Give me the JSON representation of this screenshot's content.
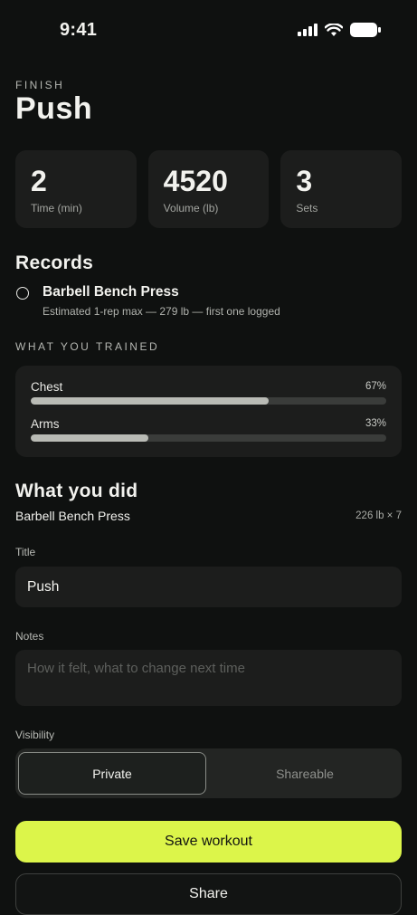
{
  "status": {
    "time": "9:41"
  },
  "header": {
    "eyebrow": "FINISH",
    "title": "Push"
  },
  "stats": [
    {
      "value": "2",
      "label": "Time (min)"
    },
    {
      "value": "4520",
      "label": "Volume (lb)"
    },
    {
      "value": "3",
      "label": "Sets"
    }
  ],
  "records": {
    "title": "Records",
    "items": [
      {
        "name": "Barbell Bench Press",
        "detail": "Estimated 1-rep max — 279 lb — first one logged"
      }
    ]
  },
  "trained": {
    "eyebrow": "WHAT YOU TRAINED",
    "muscles": [
      {
        "name": "Chest",
        "percent_label": "67%",
        "fraction": 0.67
      },
      {
        "name": "Arms",
        "percent_label": "33%",
        "fraction": 0.33
      }
    ]
  },
  "did": {
    "title": "What you did",
    "exercises": [
      {
        "name": "Barbell Bench Press",
        "meta": "226 lb × 7"
      }
    ]
  },
  "form": {
    "title_label": "Title",
    "title_value": "Push",
    "notes_label": "Notes",
    "notes_placeholder": "How it felt, what to change next time",
    "visibility_label": "Visibility",
    "visibility_options": [
      "Private",
      "Shareable"
    ],
    "visibility_selected": "Private"
  },
  "actions": {
    "save_label": "Save workout",
    "share_label": "Share"
  },
  "colors": {
    "accent": "#dcf54a",
    "background": "#0f1110",
    "card": "#1c1d1c"
  }
}
